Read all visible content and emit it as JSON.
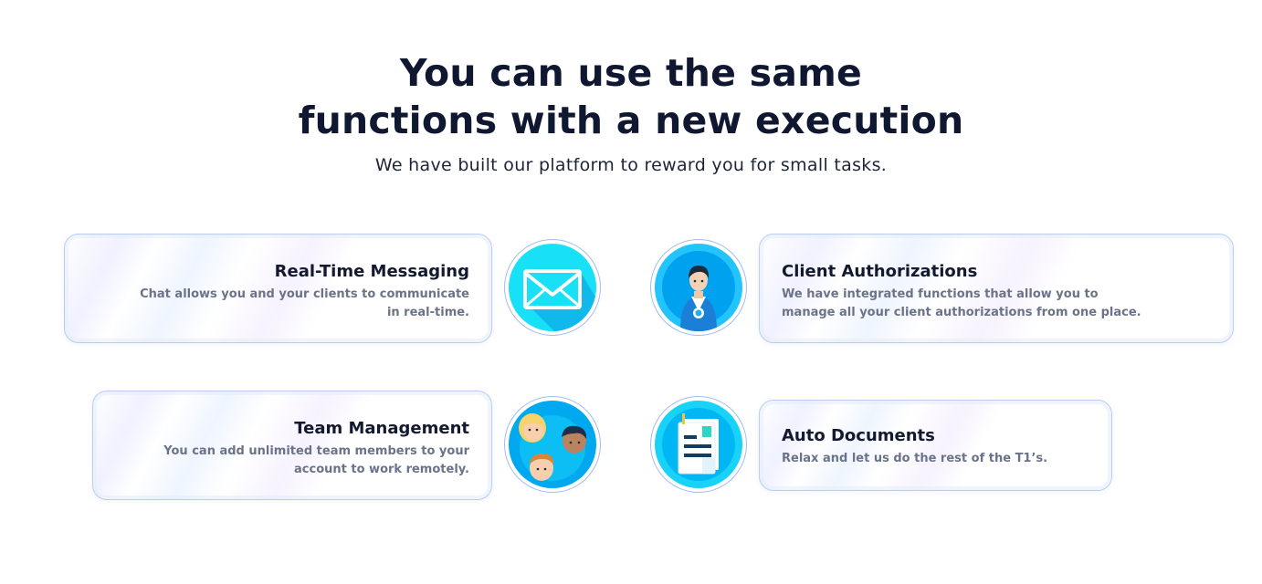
{
  "heading": {
    "line1": "You can use the same",
    "line2": "functions with a new execution"
  },
  "subtitle": "We have built our platform to reward you for small tasks.",
  "features": [
    {
      "title": "Real-Time Messaging",
      "desc_line1": "Chat allows you and your clients to communicate",
      "desc_line2": "in real-time.",
      "icon": "envelope-icon"
    },
    {
      "title": "Client Authorizations",
      "desc_line1": "We have integrated functions that allow you to",
      "desc_line2": "manage all your client authorizations from one place.",
      "icon": "client-badge-icon"
    },
    {
      "title": "Team Management",
      "desc_line1": "You can add unlimited team members to your",
      "desc_line2": "account to work remotely.",
      "icon": "team-icon"
    },
    {
      "title": "Auto Documents",
      "desc_line1": "Relax and let us do the rest of the T1’s.",
      "icon": "document-icon"
    }
  ],
  "colors": {
    "heading": "#0f1731",
    "icon_blue": "#00b7f5",
    "icon_cyan": "#18e1f7",
    "card_border": "#b9cdf3",
    "desc_gray": "#6b7388"
  }
}
